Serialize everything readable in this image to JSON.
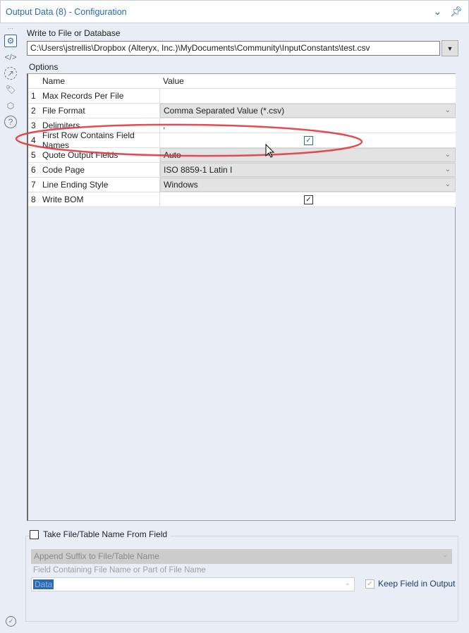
{
  "title": "Output Data (8) - Configuration",
  "write_label": "Write to File or Database",
  "path_value": "C:\\Users\\jstrellis\\Dropbox (Alteryx, Inc.)\\MyDocuments\\Community\\InputConstants\\test.csv",
  "options_label": "Options",
  "grid": {
    "headers": [
      "Name",
      "Value"
    ],
    "rows": [
      {
        "num": "1",
        "name": "Max Records Per File",
        "value": "",
        "type": "text"
      },
      {
        "num": "2",
        "name": "File Format",
        "value": "Comma Separated Value (*.csv)",
        "type": "dropdown"
      },
      {
        "num": "3",
        "name": "Delimiters",
        "value": ",",
        "type": "text"
      },
      {
        "num": "4",
        "name": "First Row Contains Field Names",
        "value": "checked",
        "type": "checkbox"
      },
      {
        "num": "5",
        "name": "Quote Output Fields",
        "value": "Auto",
        "type": "dropdown"
      },
      {
        "num": "6",
        "name": "Code Page",
        "value": "ISO 8859-1 Latin I",
        "type": "dropdown"
      },
      {
        "num": "7",
        "name": "Line Ending Style",
        "value": "Windows",
        "type": "dropdown"
      },
      {
        "num": "8",
        "name": "Write BOM",
        "value": "checked",
        "type": "checkbox"
      }
    ]
  },
  "take_name": {
    "label": "Take File/Table Name From Field",
    "checked": false
  },
  "append_option": "Append Suffix to File/Table Name",
  "field_label": "Field Containing File Name or Part of File Name",
  "field_value": "Data",
  "keep_field": {
    "label": "Keep Field in Output",
    "checked": true
  },
  "annotation_color": "#e0393e",
  "accent": "#2a6bb0"
}
